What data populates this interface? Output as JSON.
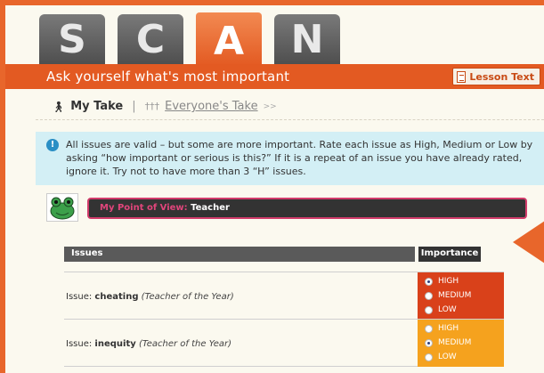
{
  "tabs": [
    {
      "letter": "S",
      "active": false
    },
    {
      "letter": "C",
      "active": false
    },
    {
      "letter": "A",
      "active": true
    },
    {
      "letter": "N",
      "active": false
    }
  ],
  "banner": {
    "title": "Ask yourself what's most important",
    "lesson_button": "Lesson Text"
  },
  "takes": {
    "my_take": "My Take",
    "separator": "|",
    "everyone_take": "Everyone's Take",
    "more": ">>"
  },
  "info": {
    "text": "All issues are valid – but some are more important. Rate each issue as High, Medium or Low by asking “how important or serious is this?” If it is a repeat of an issue you have already rated, ignore it. Try not to have more than 3 “H” issues."
  },
  "pov": {
    "label": "My Point of View:",
    "value": "Teacher"
  },
  "table": {
    "headers": {
      "issues": "Issues",
      "importance": "Importance"
    },
    "rows": [
      {
        "prefix": "Issue:",
        "name": "cheating",
        "source": "(Teacher of the Year)",
        "options": [
          "HIGH",
          "MEDIUM",
          "LOW"
        ],
        "selected": 0,
        "color": "#d9411a"
      },
      {
        "prefix": "Issue:",
        "name": "inequity",
        "source": "(Teacher of the Year)",
        "options": [
          "HIGH",
          "MEDIUM",
          "LOW"
        ],
        "selected": 1,
        "color": "#f5a21e"
      }
    ]
  },
  "colors": {
    "accent": "#e35a22",
    "pov_border": "#d23c6b",
    "info_bg": "#d3eff5"
  }
}
